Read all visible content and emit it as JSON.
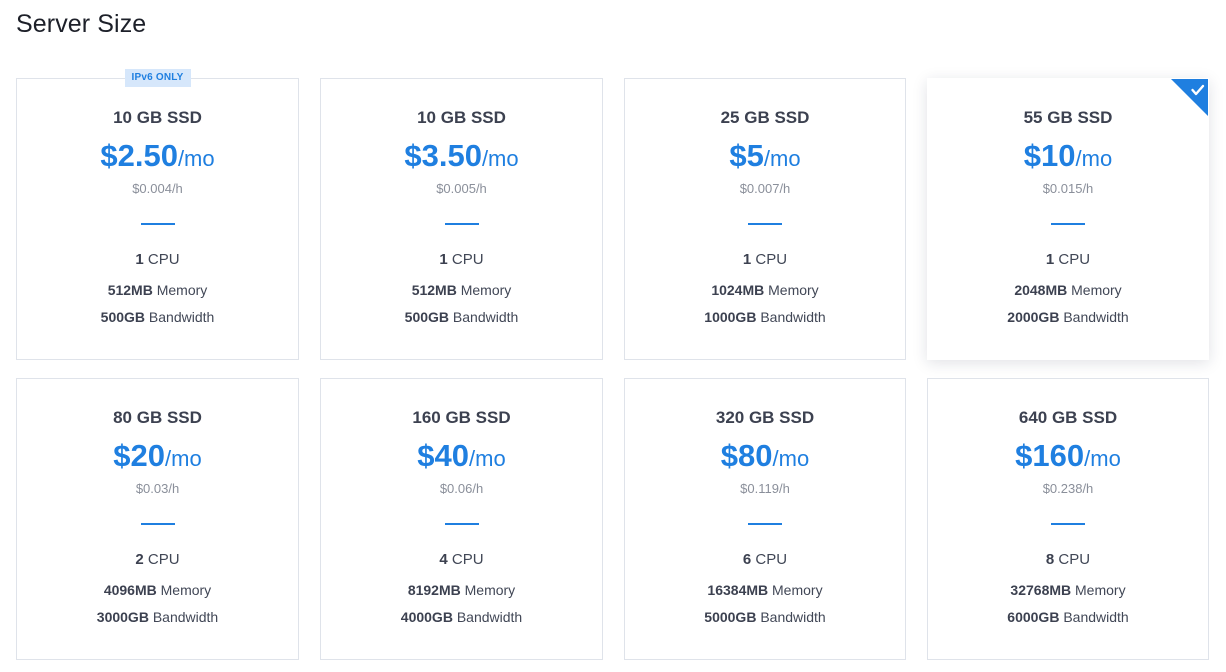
{
  "page": {
    "title": "Server Size"
  },
  "colors": {
    "accent": "#1f7fe0",
    "badge_bg": "#d6e7fb",
    "border": "#dfe3ea",
    "muted_text": "#8a8f9a"
  },
  "plans": [
    {
      "storage": "10 GB SSD",
      "price": "$2.50",
      "unit": "/mo",
      "hourly": "$0.004/h",
      "cpu_count": "1",
      "cpu_label": " CPU",
      "memory": "512MB",
      "memory_label": " Memory",
      "bandwidth": "500GB",
      "bandwidth_label": " Bandwidth",
      "badge": "IPv6 ONLY",
      "selected": false
    },
    {
      "storage": "10 GB SSD",
      "price": "$3.50",
      "unit": "/mo",
      "hourly": "$0.005/h",
      "cpu_count": "1",
      "cpu_label": " CPU",
      "memory": "512MB",
      "memory_label": " Memory",
      "bandwidth": "500GB",
      "bandwidth_label": " Bandwidth",
      "selected": false
    },
    {
      "storage": "25 GB SSD",
      "price": "$5",
      "unit": "/mo",
      "hourly": "$0.007/h",
      "cpu_count": "1",
      "cpu_label": " CPU",
      "memory": "1024MB",
      "memory_label": " Memory",
      "bandwidth": "1000GB",
      "bandwidth_label": " Bandwidth",
      "selected": false
    },
    {
      "storage": "55 GB SSD",
      "price": "$10",
      "unit": "/mo",
      "hourly": "$0.015/h",
      "cpu_count": "1",
      "cpu_label": " CPU",
      "memory": "2048MB",
      "memory_label": " Memory",
      "bandwidth": "2000GB",
      "bandwidth_label": " Bandwidth",
      "selected": true
    },
    {
      "storage": "80 GB SSD",
      "price": "$20",
      "unit": "/mo",
      "hourly": "$0.03/h",
      "cpu_count": "2",
      "cpu_label": " CPU",
      "memory": "4096MB",
      "memory_label": " Memory",
      "bandwidth": "3000GB",
      "bandwidth_label": " Bandwidth",
      "selected": false
    },
    {
      "storage": "160 GB SSD",
      "price": "$40",
      "unit": "/mo",
      "hourly": "$0.06/h",
      "cpu_count": "4",
      "cpu_label": " CPU",
      "memory": "8192MB",
      "memory_label": " Memory",
      "bandwidth": "4000GB",
      "bandwidth_label": " Bandwidth",
      "selected": false
    },
    {
      "storage": "320 GB SSD",
      "price": "$80",
      "unit": "/mo",
      "hourly": "$0.119/h",
      "cpu_count": "6",
      "cpu_label": " CPU",
      "memory": "16384MB",
      "memory_label": " Memory",
      "bandwidth": "5000GB",
      "bandwidth_label": " Bandwidth",
      "selected": false
    },
    {
      "storage": "640 GB SSD",
      "price": "$160",
      "unit": "/mo",
      "hourly": "$0.238/h",
      "cpu_count": "8",
      "cpu_label": " CPU",
      "memory": "32768MB",
      "memory_label": " Memory",
      "bandwidth": "6000GB",
      "bandwidth_label": " Bandwidth",
      "selected": false
    }
  ]
}
